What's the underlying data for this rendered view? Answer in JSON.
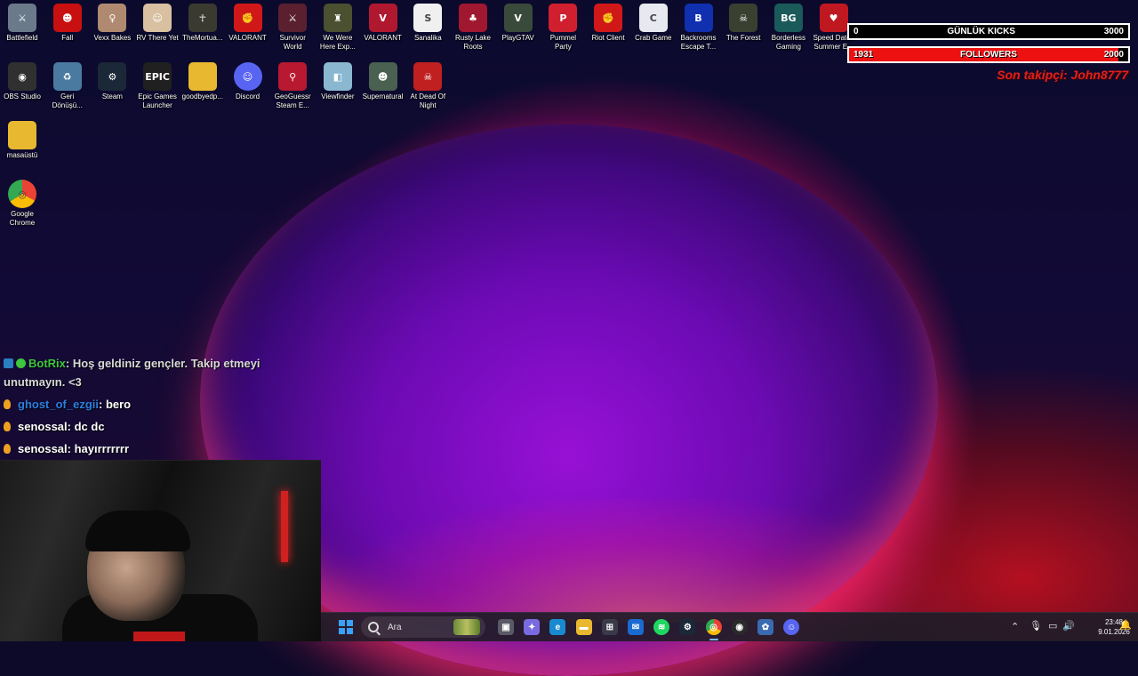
{
  "desktop": {
    "icons": [
      {
        "label": "Battlefield",
        "icon": "battlefield-icon",
        "color": "#6a7a8a",
        "glyph": "⚔"
      },
      {
        "label": "Fall",
        "icon": "game-icon",
        "color": "#c81010",
        "glyph": "☻"
      },
      {
        "label": "Vexx Bakes",
        "icon": "game-icon",
        "color": "#b08a70",
        "glyph": "♀"
      },
      {
        "label": "RV There Yet",
        "icon": "game-icon",
        "color": "#d8c0a0",
        "glyph": "☺"
      },
      {
        "label": "TheMortua...",
        "icon": "game-icon",
        "color": "#3a3a30",
        "glyph": "☥"
      },
      {
        "label": "VALORANT",
        "icon": "riot-icon",
        "color": "#d01818",
        "glyph": "✊"
      },
      {
        "label": "Survivor World",
        "icon": "game-icon",
        "color": "#5a2030",
        "glyph": "⚔"
      },
      {
        "label": "We Were Here Exp...",
        "icon": "game-icon",
        "color": "#4a5030",
        "glyph": "♜"
      },
      {
        "label": "VALORANT",
        "icon": "valorant-icon",
        "color": "#b01830",
        "glyph": "V"
      },
      {
        "label": "Sanalika",
        "icon": "game-icon",
        "color": "#f0f0f0",
        "glyph": "S"
      },
      {
        "label": "Rusty Lake Roots",
        "icon": "game-icon",
        "color": "#a01830",
        "glyph": "♣"
      },
      {
        "label": "PlayGTAV",
        "icon": "gta-icon",
        "color": "#3a4a3a",
        "glyph": "V"
      },
      {
        "label": "Pummel Party",
        "icon": "game-icon",
        "color": "#d02030",
        "glyph": "P"
      },
      {
        "label": "Riot Client",
        "icon": "riot-icon",
        "color": "#d01818",
        "glyph": "✊"
      },
      {
        "label": "Crab Game",
        "icon": "game-icon",
        "color": "#e8e8f0",
        "glyph": "C"
      },
      {
        "label": "Backrooms Escape T...",
        "icon": "game-icon",
        "color": "#1030b0",
        "glyph": "B"
      },
      {
        "label": "The Forest",
        "icon": "game-icon",
        "color": "#3a4030",
        "glyph": "☠"
      },
      {
        "label": "Borderless Gaming",
        "icon": "game-icon",
        "color": "#1a5a5a",
        "glyph": "BG"
      },
      {
        "label": "Speed Dates Summer E...",
        "icon": "game-icon",
        "color": "#c01820",
        "glyph": "♥"
      },
      {
        "label": "OBS Studio",
        "icon": "obs-icon",
        "color": "#303030",
        "glyph": "◉"
      },
      {
        "label": "Geri Dönüşü...",
        "icon": "recycle-bin-icon",
        "color": "#4a7aa0",
        "glyph": "♻"
      },
      {
        "label": "Steam",
        "icon": "steam-icon",
        "color": "#1b2838",
        "glyph": "⚙"
      },
      {
        "label": "Epic Games Launcher",
        "icon": "epic-icon",
        "color": "#202020",
        "glyph": "EPIC"
      },
      {
        "label": "goodbyedp...",
        "icon": "folder-icon",
        "color": "#e8b830",
        "glyph": ""
      },
      {
        "label": "Discord",
        "icon": "discord-icon",
        "color": "#5865f2",
        "glyph": "☺"
      },
      {
        "label": "GeoGuessr Steam E...",
        "icon": "geoguessr-icon",
        "color": "#b81830",
        "glyph": "⚲"
      },
      {
        "label": "Viewfinder",
        "icon": "game-icon",
        "color": "#8ab8d0",
        "glyph": "◧"
      },
      {
        "label": "Supernatural",
        "icon": "game-icon",
        "color": "#4a6050",
        "glyph": "☻"
      },
      {
        "label": "At Dead Of Night",
        "icon": "game-icon",
        "color": "#c02020",
        "glyph": "☠"
      },
      {
        "label": "masaüstü",
        "icon": "folder-icon",
        "color": "#e8b830",
        "glyph": ""
      },
      {
        "label": "Google Chrome",
        "icon": "chrome-icon",
        "color": "#ffffff",
        "glyph": "◎"
      }
    ]
  },
  "overlay": {
    "kicks": {
      "left": "0",
      "label": "GÜNLÜK KICKS",
      "right": "3000",
      "fill_color": "#111111",
      "progress": 0
    },
    "followers": {
      "left": "1931",
      "label": "FOLLOWERS",
      "right": "2000",
      "fill_color": "#ee1111",
      "progress": 0.9655
    },
    "last_follower": "Son takipçi: John8777"
  },
  "chat": {
    "messages": [
      {
        "user": "BotRix",
        "user_color": "#3ec63e",
        "text": ": Hoş geldiniz gençler. Takip etmeyi unutmayın. <3",
        "badge_color": "#2a7fc0",
        "bot": true
      },
      {
        "user": "ghost_of_ezgii",
        "user_color": "#2a7fe0",
        "text": ": bero",
        "badge_color": "#f0a020",
        "bot": false
      },
      {
        "user": "senossal",
        "user_color": "#ffffff",
        "text": ": dc dc",
        "badge_color": "#f0a020",
        "bot": false
      },
      {
        "user": "senossal",
        "user_color": "#ffffff",
        "text": ": hayırrrrrrr",
        "badge_color": "#f0a020",
        "bot": false
      }
    ]
  },
  "taskbar": {
    "search_placeholder": "Ara",
    "apps": [
      {
        "name": "taskview-icon",
        "color": "#5a5a66",
        "glyph": "▣"
      },
      {
        "name": "copilot-icon",
        "color": "#7a6ae0",
        "glyph": "✦"
      },
      {
        "name": "edge-icon",
        "color": "#1a8ad0",
        "glyph": "e"
      },
      {
        "name": "file-explorer-icon",
        "color": "#e8b830",
        "glyph": "▬"
      },
      {
        "name": "store-icon",
        "color": "#3a3a48",
        "glyph": "⊞"
      },
      {
        "name": "mail-icon",
        "color": "#1a6ad0",
        "glyph": "✉"
      },
      {
        "name": "spotify-icon",
        "color": "#1ed760",
        "glyph": "≋"
      },
      {
        "name": "steam-icon",
        "color": "#1b2838",
        "glyph": "⚙"
      },
      {
        "name": "chrome-icon",
        "color": "#e8e8e8",
        "glyph": "◎"
      },
      {
        "name": "obs-icon",
        "color": "#2a2a2a",
        "glyph": "◉"
      },
      {
        "name": "app-icon",
        "color": "#3a6ab0",
        "glyph": "✿"
      },
      {
        "name": "discord-icon",
        "color": "#5865f2",
        "glyph": "☺"
      }
    ],
    "time": "23:48",
    "date": "9.01.2026"
  }
}
